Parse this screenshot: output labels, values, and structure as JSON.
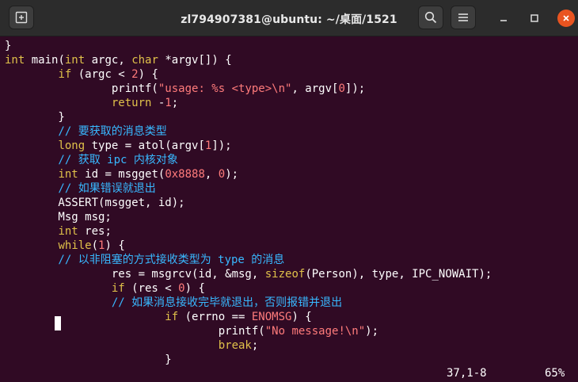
{
  "window": {
    "title": "zl794907381@ubuntu: ~/桌面/1521"
  },
  "icons": {
    "new_tab": "new-tab-icon",
    "search": "search-icon",
    "menu": "hamburger-menu-icon",
    "minimize": "minimize-icon",
    "maximize": "maximize-icon",
    "close": "close-icon"
  },
  "colors": {
    "terminal_bg": "#300a24",
    "titlebar_bg": "#2c2c2c",
    "close_button": "#e95420",
    "keyword": "#e0c14a",
    "literal": "#ff7b7b",
    "comment": "#38b8ff"
  },
  "code": {
    "l1": "}",
    "l2a": "int",
    "l2b": " main(",
    "l2c": "int",
    "l2d": " argc, ",
    "l2e": "char",
    "l2f": " *argv[]) {",
    "l3a": "        ",
    "l3b": "if",
    "l3c": " (argc < ",
    "l3d": "2",
    "l3e": ") {",
    "l4a": "                printf(",
    "l4b": "\"usage: %s <type>\\n\"",
    "l4c": ", argv[",
    "l4d": "0",
    "l4e": "]);",
    "l5a": "                ",
    "l5b": "return",
    "l5c": " -",
    "l5d": "1",
    "l5e": ";",
    "l6": "        }",
    "l7": "        // 要获取的消息类型",
    "l8a": "        ",
    "l8b": "long",
    "l8c": " type = atol(argv[",
    "l8d": "1",
    "l8e": "]);",
    "l9": "        // 获取 ipc 内核对象",
    "l10a": "        ",
    "l10b": "int",
    "l10c": " id = msgget(",
    "l10d": "0x8888",
    "l10e": ", ",
    "l10f": "0",
    "l10g": ");",
    "l11": "        // 如果错误就退出",
    "l12": "        ASSERT(msgget, id);",
    "l13": "        Msg msg;",
    "l14a": "        ",
    "l14b": "int",
    "l14c": " res;",
    "l15a": "        ",
    "l15b": "while",
    "l15c": "(",
    "l15d": "1",
    "l15e": ") {",
    "l16": "        // 以非阻塞的方式接收类型为 type 的消息",
    "l17a": "                res = msgrcv(id, &msg, ",
    "l17b": "sizeof",
    "l17c": "(Person), type, IPC_NOWAIT);",
    "l18a": "                ",
    "l18b": "if",
    "l18c": " (res < ",
    "l18d": "0",
    "l18e": ") {",
    "l19": "                // 如果消息接收完毕就退出，否则报错并退出",
    "l20a": "                        ",
    "l20b": "if",
    "l20c": " (errno == ",
    "l20d": "ENOMSG",
    "l20e": ") {",
    "l21a": "                                printf(",
    "l21b": "\"No message!\\n\"",
    "l21c": ");",
    "l22a": "                                ",
    "l22b": "break",
    "l22c": ";",
    "l23": "                        }"
  },
  "status": {
    "position": "37,1-8",
    "percent": "65%"
  }
}
